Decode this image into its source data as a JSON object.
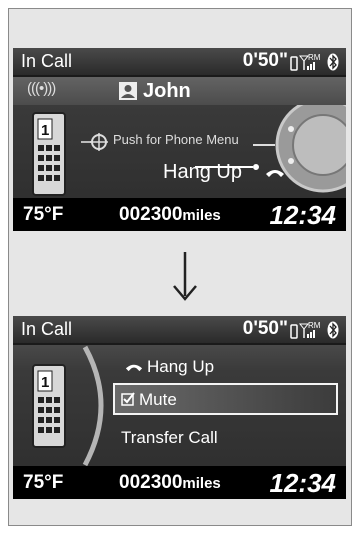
{
  "top": {
    "title": "In Call",
    "timer": "0'50\"",
    "signal": "(((•)))",
    "caller": "John",
    "push_hint": "Push for Phone Menu",
    "hangup": "Hang Up",
    "temperature": "75°F",
    "odometer": "002300",
    "odometer_unit": "miles",
    "clock": "12:34",
    "roaming": "RM"
  },
  "bottom": {
    "title": "In Call",
    "timer": "0'50\"",
    "menu": [
      "Hang Up",
      "Mute",
      "Transfer Call"
    ],
    "selected": "Mute",
    "temperature": "75°F",
    "odometer": "002300",
    "odometer_unit": "miles",
    "clock": "12:34",
    "roaming": "RM"
  },
  "icons": [
    "phone-device-icon",
    "signal-bars-icon",
    "bluetooth-icon",
    "contact-icon",
    "handset-icon",
    "check-icon",
    "interface-dial-icon",
    "down-arrow-icon"
  ]
}
